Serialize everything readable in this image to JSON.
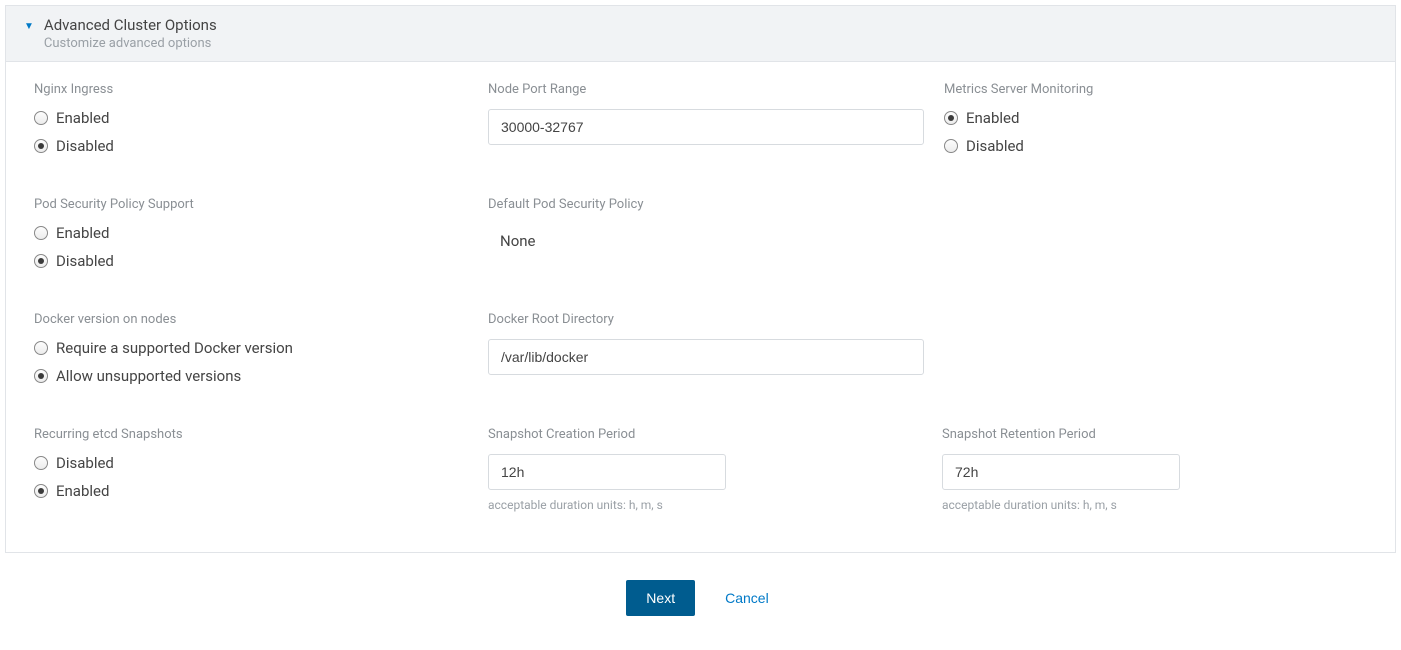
{
  "header": {
    "title": "Advanced Cluster Options",
    "subtitle": "Customize advanced options"
  },
  "nginx_ingress": {
    "label": "Nginx Ingress",
    "options": {
      "enabled": "Enabled",
      "disabled": "Disabled"
    },
    "selected": "disabled"
  },
  "node_port_range": {
    "label": "Node Port Range",
    "value": "30000-32767"
  },
  "metrics_server": {
    "label": "Metrics Server Monitoring",
    "options": {
      "enabled": "Enabled",
      "disabled": "Disabled"
    },
    "selected": "enabled"
  },
  "pod_security": {
    "label": "Pod Security Policy Support",
    "options": {
      "enabled": "Enabled",
      "disabled": "Disabled"
    },
    "selected": "disabled"
  },
  "default_pod_security": {
    "label": "Default Pod Security Policy",
    "value": "None"
  },
  "docker_version": {
    "label": "Docker version on nodes",
    "options": {
      "require": "Require a supported Docker version",
      "allow": "Allow unsupported versions"
    },
    "selected": "allow"
  },
  "docker_root": {
    "label": "Docker Root Directory",
    "value": "/var/lib/docker"
  },
  "etcd_snapshots": {
    "label": "Recurring etcd Snapshots",
    "options": {
      "disabled": "Disabled",
      "enabled": "Enabled"
    },
    "selected": "enabled"
  },
  "snapshot_creation": {
    "label": "Snapshot Creation Period",
    "value": "12h",
    "hint": "acceptable duration units: h, m, s"
  },
  "snapshot_retention": {
    "label": "Snapshot Retention Period",
    "value": "72h",
    "hint": "acceptable duration units: h, m, s"
  },
  "footer": {
    "next": "Next",
    "cancel": "Cancel"
  }
}
